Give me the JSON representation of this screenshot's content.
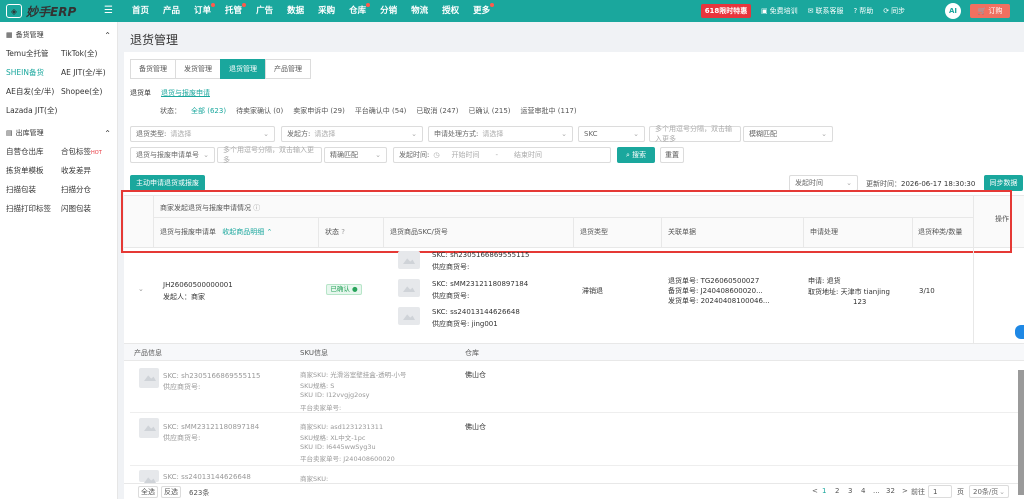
{
  "topbar": {
    "logo_text": "妙手ERP",
    "menu": [
      "首页",
      "产品",
      "订单",
      "托管",
      "广告",
      "数据",
      "采购",
      "仓库",
      "分销",
      "物流",
      "授权",
      "更多"
    ],
    "promo": "618限时特惠",
    "right_items": [
      "免费培训",
      "联系客服",
      "帮助",
      "同步"
    ],
    "ai": "AI",
    "order_btn": "订购"
  },
  "sidebar": {
    "group1": {
      "title": "备货管理",
      "items": [
        "Temu全托管",
        "TikTok(全)",
        "SHEIN备货",
        "AE JIT(全/半)",
        "AE自发(全/半)",
        "Shopee(全)",
        "Lazada JIT(全)"
      ]
    },
    "group2": {
      "title": "出库管理",
      "items": [
        "自营仓出库",
        "合包标签",
        "拣货单模板",
        "收发差异",
        "扫描包装",
        "扫描分仓",
        "扫描打印标签",
        "闪图包装"
      ],
      "hot": "HOT"
    }
  },
  "page": {
    "title": "退货管理",
    "tabs": [
      "备货管理",
      "发货管理",
      "退货管理",
      "产品管理"
    ],
    "subtabs": [
      "退货单",
      "退货与报废申请"
    ],
    "status_label": "状态：",
    "statuses": [
      "全部 (623)",
      "待卖家确认 (0)",
      "卖家申诉中 (29)",
      "平台确认中 (54)",
      "已取消 (247)",
      "已确认 (215)",
      "运营审批中 (117)"
    ]
  },
  "filters": {
    "return_type": {
      "label": "退货类型:",
      "ph": "请选择"
    },
    "origin": {
      "label": "发起方:",
      "ph": "请选择"
    },
    "method": {
      "label": "申请处理方式:",
      "ph": "请选择"
    },
    "skc": {
      "label": "SKC",
      "ph": "多个用逗号分隔，双击输入更多"
    },
    "fuzzy1": "模糊匹配",
    "apply_no": {
      "label": "退货与报废申请单号",
      "ph": "多个用逗号分隔，双击输入更多"
    },
    "fuzzy2": "精确匹配",
    "time": {
      "label": "发起时间:",
      "start": "开始时间",
      "sep": "-",
      "end": "结束时间"
    },
    "search": "搜索",
    "reset": "重置"
  },
  "actions": {
    "create": "主动申请退货或报废",
    "sort": "发起时间",
    "updated_label": "更新时间：",
    "updated": "2026-06-17 18:30:30",
    "sync": "同步数据"
  },
  "table": {
    "head_top": "商家发起退货与报废申请情况",
    "col_apply": "退货与报废申请单",
    "collapse": "收起商品明细",
    "col_status": "状态",
    "col_skc": "退货商品SKC/货号",
    "col_type": "退货类型",
    "col_related": "关联单据",
    "col_process": "申请处理",
    "col_count": "退货种类/数量",
    "col_op": "操作"
  },
  "row": {
    "apply_no": "JH26060500000001",
    "origin": "发起人：商家",
    "status": "已确认",
    "items": [
      {
        "skc": "SKC:  sh2305166869555115",
        "sup": "供应商货号:"
      },
      {
        "skc": "SKC:  sMM23121180897184",
        "sup": "供应商货号:"
      },
      {
        "skc": "SKC:  ss24013144626648",
        "sup": "供应商货号:  jing001"
      }
    ],
    "type": "滞销退",
    "related": [
      "退货单号:  TG26060500027",
      "备货单号:  J240408600020...",
      "发货单号:  20240408100046..."
    ],
    "process_1": "申请:  退货",
    "process_2": "取货地址:  天津市 tianjing",
    "process_3": "123",
    "count": "3/10"
  },
  "detail": {
    "head": [
      "产品信息",
      "SKU信息",
      "仓库"
    ],
    "rows": [
      {
        "skc": "SKC:  sh2305166869555115",
        "sup": "供应商货号:",
        "sku1": "商家SKU:  光滑浴室壁挂盒-透明-小号",
        "sku2": "SKU规格:  S",
        "sku3": "SKU ID:  I12vvgjg2osy",
        "sku4": "平台卖家单号:",
        "wh": "佛山仓"
      },
      {
        "skc": "SKC:  sMM23121180897184",
        "sup": "供应商货号:",
        "sku1": "商家SKU:  asd1231231311",
        "sku2": "SKU规格:  XL中文-1pc",
        "sku3": "SKU ID:  I6445wwSyg3u",
        "sku4": "平台卖家单号:  J240408600020",
        "wh": "佛山仓"
      },
      {
        "skc": "SKC:  ss24013144626648",
        "sup": "",
        "sku1": "商家SKU:",
        "sku2": "",
        "sku3": "",
        "sku4": "",
        "wh": ""
      }
    ]
  },
  "footer": {
    "all": "全选",
    "invert": "反选",
    "count": "623条",
    "pages": [
      "1",
      "2",
      "3",
      "4",
      "...",
      "32"
    ],
    "prev": "<",
    "next": ">",
    "goto": "前往",
    "page_val": "1",
    "page_unit": "页",
    "per_page": "20条/页"
  }
}
